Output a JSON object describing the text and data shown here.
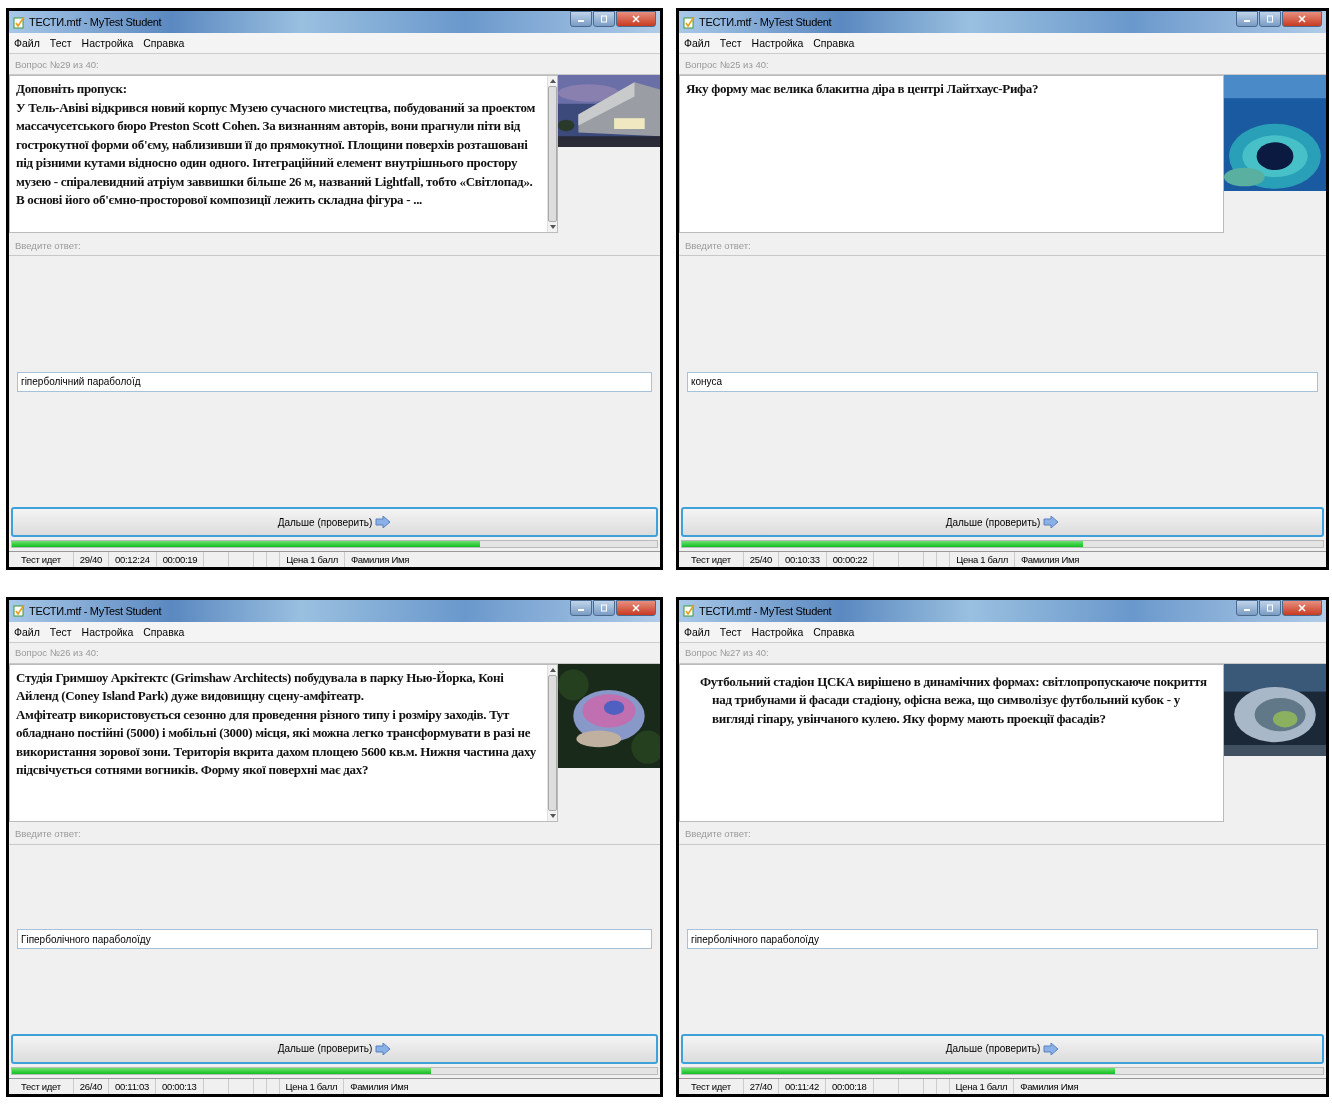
{
  "windows": [
    {
      "title": "ТЕСТИ.mtf - MyTest Student",
      "menu": [
        "Файл",
        "Тест",
        "Настройка",
        "Справка"
      ],
      "question_label": "Вопрос №29 из 40:",
      "scrollable": true,
      "indent": false,
      "question": [
        "Доповніть пропуск:",
        "У Тель-Авіві відкрився новий корпус Музею сучасного мистецтва, побудований за проектом массачусетського бюро Preston Scott Cohen. За визнанням авторів, вони прагнули піти від гострокутної форми об'єму, наблизивши її до прямокутної. Площини поверхів розташовані під різними кутами відносно один одного. Інтеграційний елемент внутрішнього простору музею - спіралевидний атріум заввишки більше 26 м, названий Lightfall, тобто «Світлопад». В основі його об'ємно-просторової композиції лежить складна фігура - ..."
      ],
      "picture": {
        "kind": "picture"
      },
      "answer_label": "Введите ответ:",
      "answer": "гіперболічний параболоїд",
      "button": "Дальше (проверить)",
      "progress": {
        "level": 0.725
      },
      "status": {
        "state": "Тест идет",
        "count": "29/40",
        "time": "00:12:24",
        "elapsed": "00:00:19",
        "price": "Цена 1 балл",
        "name": "Фамилия Имя"
      }
    },
    {
      "title": "ТЕСТИ.mtf - MyTest Student",
      "menu": [
        "Файл",
        "Тест",
        "Настройка",
        "Справка"
      ],
      "question_label": "Вопрос №25 из 40:",
      "scrollable": false,
      "indent": false,
      "question": [
        "Яку форму має велика блакитна діра  в центрі Лайтхаус-Рифа?"
      ],
      "picture": {
        "kind": "picture"
      },
      "answer_label": "Введите ответ:",
      "answer": "конуса",
      "button": "Дальше (проверить)",
      "progress": {
        "level": 0.625
      },
      "status": {
        "state": "Тест идет",
        "count": "25/40",
        "time": "00:10:33",
        "elapsed": "00:00:22",
        "price": "Цена 1 балл",
        "name": "Фамилия Имя"
      }
    },
    {
      "title": "ТЕСТИ.mtf - MyTest Student",
      "menu": [
        "Файл",
        "Тест",
        "Настройка",
        "Справка"
      ],
      "question_label": "Вопрос №26 из 40:",
      "scrollable": true,
      "indent": false,
      "question": [
        "Студія Гримшоу Аркітектс (Grimshaw Architects) побудувала в парку Нью-Йорка, Коні Айленд (Coney Island Park) дуже видовищну сцену-амфітеатр.",
        "Амфітеатр використовується сезонно для проведення різного типу і розміру заходів. Тут обладнано постійні (5000) і мобільні (3000) місця, які можна легко трансформувати в разі не використання зорової зони. Територія вкрита дахом площею 5600 кв.м. Нижня частина даху підсвічується сотнями вогників. Форму якої поверхні має дах?"
      ],
      "picture": {
        "kind": "picture"
      },
      "answer_label": "Введите ответ:",
      "answer": "Гіперболічного параболоїду",
      "button": "Дальше (проверить)",
      "progress": {
        "level": 0.65
      },
      "status": {
        "state": "Тест идет",
        "count": "26/40",
        "time": "00:11:03",
        "elapsed": "00:00:13",
        "price": "Цена 1 балл",
        "name": "Фамилия Имя"
      }
    },
    {
      "title": "ТЕСТИ.mtf - MyTest Student",
      "menu": [
        "Файл",
        "Тест",
        "Настройка",
        "Справка"
      ],
      "question_label": "Вопрос №27 из 40:",
      "scrollable": false,
      "indent": true,
      "question": [
        "Футбольний стадіон ЦСКА вирішено в динамічних формах: світлопропускаюче покриття над трибунами й фасади стадіону, офісна вежа, що символізує футбольний кубок - у вигляді гіпару, увінчаного кулею. Яку форму мають проекції фасадів?"
      ],
      "picture": {
        "kind": "picture"
      },
      "answer_label": "Введите ответ:",
      "answer": "гіперболічного параболоїду",
      "button": "Дальше (проверить)",
      "progress": {
        "level": 0.675
      },
      "status": {
        "state": "Тест идет",
        "count": "27/40",
        "time": "00:11:42",
        "elapsed": "00:00:18",
        "price": "Цена 1 балл",
        "name": "Фамилия Имя"
      }
    }
  ]
}
